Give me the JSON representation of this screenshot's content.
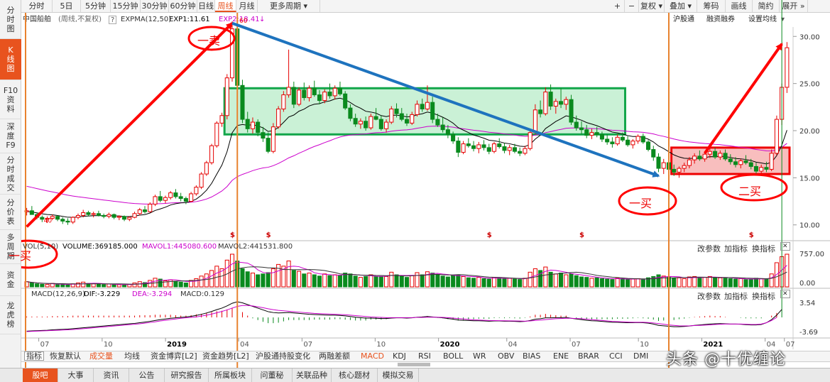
{
  "left_nav": {
    "items": [
      "分时图",
      "K线图",
      "F10资料",
      "深度F9",
      "分时成交",
      "分价表",
      "多周期",
      "资金",
      "龙虎榜"
    ]
  },
  "toolbar": {
    "periods": [
      "分时",
      "5日",
      "5分钟",
      "15分钟",
      "30分钟",
      "60分钟",
      "日线",
      "周线",
      "月线",
      "更多周期"
    ],
    "right": [
      "+",
      "−",
      "复权",
      "叠加",
      "筹码",
      "画线",
      "简约",
      "展开"
    ]
  },
  "info_bar": {
    "stock": "中国船舶",
    "mode": "(周线,不复权)",
    "help": "?",
    "expma": "EXPMA(12,50)",
    "exp1": "EXP1:11.61",
    "exp2": "EXP2:18.41",
    "right_links": [
      "沪股通",
      "融资融券",
      "设置均线"
    ]
  },
  "price_axis": [
    "30.00",
    "25.00",
    "20.00",
    "15.00",
    "10.00"
  ],
  "volume_panel": {
    "title": "VOL(5,10)",
    "volume": "VOLUME:369185.000",
    "mavol1": "MAVOL1:445080.600",
    "mavol2": "MAVOL2:441531.800",
    "axis": [
      "757.00",
      "0.00"
    ],
    "buttons": [
      "改参数",
      "加指标",
      "换指标"
    ]
  },
  "macd_panel": {
    "title": "MACD(12,26,9)",
    "dif": "DIF:-3.229",
    "dea": "DEA:-3.294",
    "macd": "MACD:0.129",
    "axis": [
      "3.54",
      "-3.69"
    ],
    "buttons": [
      "改参数",
      "加指标",
      "换指标"
    ]
  },
  "time_axis": [
    {
      "label": "07",
      "year": false
    },
    {
      "label": "10",
      "year": false
    },
    {
      "label": "2019",
      "year": true
    },
    {
      "label": "04",
      "year": false
    },
    {
      "label": "07",
      "year": false
    },
    {
      "label": "10",
      "year": false
    },
    {
      "label": "2020",
      "year": true
    },
    {
      "label": "04",
      "year": false
    },
    {
      "label": "07",
      "year": false
    },
    {
      "label": "10",
      "year": false
    },
    {
      "label": "2021",
      "year": true
    },
    {
      "label": "04",
      "year": false
    },
    {
      "label": "07",
      "year": false
    }
  ],
  "labels": {
    "high": "60",
    "low": "40",
    "markers": "$"
  },
  "annotations": {
    "sell": "一卖",
    "buy1_left": "一买",
    "buy1_right": "一买",
    "buy2": "二买"
  },
  "indicator_bar": [
    "指标",
    "恢复默认",
    "成交量",
    "均线",
    "资金博弈[L2]",
    "资金趋势[L2]",
    "沪股通持股变化",
    "两融差额",
    "MACD",
    "KDJ",
    "RSI",
    "BOLL",
    "WR",
    "OBV",
    "BIAS",
    "ENE",
    "BRAR",
    "CCI",
    "DMI"
  ],
  "bottom_tabs": [
    "股吧",
    "大事",
    "资讯",
    "公告",
    "研究报告",
    "所属板块",
    "问董秘",
    "关联品种",
    "核心题材",
    "模拟交易"
  ],
  "watermark": "头条 @十优缠论",
  "colors": {
    "up": "#e60000",
    "down": "#0a8a1e",
    "accent": "#e8531e",
    "exp1": "#000000",
    "exp2": "#cc00cc",
    "trend_line": "#1e73be",
    "annotation": "#ff0000",
    "zone_fill": "#b8ecc8",
    "zone_border": "#12a64a",
    "zone2_fill": "#f5a3a3"
  },
  "chart_data": {
    "type": "candlestick",
    "scale": "linear",
    "ylim": [
      9,
      31
    ],
    "period": "weekly",
    "candles": [
      [
        11.4,
        11.8,
        11.0,
        11.5
      ],
      [
        11.5,
        12.0,
        11.2,
        11.1
      ],
      [
        11.1,
        11.3,
        10.6,
        10.8
      ],
      [
        10.8,
        11.0,
        10.3,
        10.6
      ],
      [
        10.6,
        10.9,
        10.2,
        10.7
      ],
      [
        10.7,
        11.1,
        10.5,
        10.9
      ],
      [
        10.9,
        11.0,
        10.4,
        10.6
      ],
      [
        10.6,
        10.8,
        10.1,
        10.4
      ],
      [
        10.4,
        10.7,
        10.0,
        10.3
      ],
      [
        10.3,
        10.9,
        10.1,
        10.8
      ],
      [
        10.8,
        11.2,
        10.6,
        11.0
      ],
      [
        11.0,
        11.6,
        10.8,
        11.3
      ],
      [
        11.3,
        11.5,
        10.9,
        11.1
      ],
      [
        11.1,
        11.4,
        10.8,
        11.2
      ],
      [
        11.2,
        11.5,
        10.9,
        11.0
      ],
      [
        11.0,
        11.2,
        10.7,
        10.9
      ],
      [
        10.9,
        11.3,
        10.7,
        11.1
      ],
      [
        11.1,
        11.2,
        10.6,
        10.8
      ],
      [
        10.8,
        11.0,
        10.5,
        10.9
      ],
      [
        10.9,
        11.0,
        10.4,
        10.6
      ],
      [
        10.6,
        10.9,
        10.4,
        10.8
      ],
      [
        10.8,
        11.4,
        10.7,
        11.2
      ],
      [
        11.2,
        11.8,
        11.0,
        11.6
      ],
      [
        11.6,
        12.0,
        11.2,
        11.4
      ],
      [
        11.4,
        12.4,
        11.3,
        12.2
      ],
      [
        12.2,
        13.2,
        12.0,
        13.0
      ],
      [
        13.0,
        13.6,
        12.4,
        12.6
      ],
      [
        12.6,
        13.1,
        12.3,
        12.9
      ],
      [
        12.9,
        13.6,
        12.7,
        13.4
      ],
      [
        13.4,
        13.8,
        12.8,
        13.0
      ],
      [
        13.0,
        13.4,
        12.5,
        12.8
      ],
      [
        12.8,
        13.0,
        12.2,
        12.5
      ],
      [
        12.5,
        13.5,
        12.4,
        13.3
      ],
      [
        13.3,
        14.2,
        13.1,
        14.0
      ],
      [
        14.0,
        15.6,
        13.8,
        15.4
      ],
      [
        15.4,
        16.8,
        15.2,
        16.6
      ],
      [
        16.6,
        18.6,
        16.4,
        18.4
      ],
      [
        18.4,
        21.0,
        18.2,
        20.8
      ],
      [
        20.8,
        21.9,
        20.4,
        21.6
      ],
      [
        21.6,
        26.0,
        21.2,
        25.6
      ],
      [
        25.6,
        31.6,
        25.2,
        30.8
      ],
      [
        30.8,
        31.2,
        24.5,
        24.8
      ],
      [
        24.8,
        25.4,
        20.8,
        21.2
      ],
      [
        21.2,
        22.0,
        19.8,
        20.2
      ],
      [
        20.2,
        21.4,
        19.7,
        20.9
      ],
      [
        20.9,
        21.2,
        19.4,
        19.8
      ],
      [
        19.8,
        20.4,
        18.8,
        19.2
      ],
      [
        19.2,
        19.8,
        17.6,
        17.8
      ],
      [
        17.8,
        20.8,
        17.6,
        20.4
      ],
      [
        20.4,
        22.6,
        20.2,
        22.3
      ],
      [
        22.3,
        24.2,
        22.0,
        23.8
      ],
      [
        23.8,
        28.6,
        23.5,
        24.6
      ],
      [
        24.6,
        25.2,
        22.4,
        22.8
      ],
      [
        22.8,
        24.6,
        22.6,
        24.3
      ],
      [
        24.3,
        25.1,
        23.2,
        23.5
      ],
      [
        23.5,
        24.8,
        23.1,
        24.5
      ],
      [
        24.5,
        25.3,
        23.6,
        23.8
      ],
      [
        23.8,
        24.3,
        22.8,
        23.2
      ],
      [
        23.2,
        24.4,
        22.9,
        24.1
      ],
      [
        24.1,
        25.0,
        23.4,
        23.7
      ],
      [
        23.7,
        24.8,
        23.3,
        24.5
      ],
      [
        24.5,
        25.2,
        23.7,
        23.9
      ],
      [
        23.9,
        24.2,
        22.2,
        22.4
      ],
      [
        22.4,
        22.8,
        21.0,
        21.3
      ],
      [
        21.3,
        21.8,
        20.4,
        20.7
      ],
      [
        20.7,
        21.3,
        20.2,
        21.0
      ],
      [
        21.0,
        21.5,
        20.0,
        20.3
      ],
      [
        20.3,
        21.8,
        20.1,
        21.5
      ],
      [
        21.5,
        22.4,
        21.1,
        21.2
      ],
      [
        21.2,
        21.6,
        20.0,
        20.2
      ],
      [
        20.2,
        21.2,
        19.8,
        20.9
      ],
      [
        20.9,
        22.6,
        20.7,
        22.3
      ],
      [
        22.3,
        22.9,
        21.4,
        21.8
      ],
      [
        21.8,
        22.4,
        21.0,
        21.2
      ],
      [
        21.2,
        21.8,
        20.5,
        20.8
      ],
      [
        20.8,
        22.0,
        20.6,
        21.7
      ],
      [
        21.7,
        23.2,
        21.5,
        22.8
      ],
      [
        22.8,
        23.4,
        22.0,
        22.3
      ],
      [
        22.3,
        24.8,
        22.1,
        23.0
      ],
      [
        23.0,
        23.6,
        20.8,
        21.2
      ],
      [
        21.2,
        21.8,
        20.4,
        20.6
      ],
      [
        20.6,
        21.4,
        19.8,
        20.1
      ],
      [
        20.1,
        20.6,
        19.2,
        19.6
      ],
      [
        19.6,
        19.9,
        18.6,
        18.9
      ],
      [
        18.9,
        19.3,
        17.2,
        17.7
      ],
      [
        17.7,
        18.9,
        17.5,
        18.6
      ],
      [
        18.6,
        19.2,
        18.2,
        18.4
      ],
      [
        18.4,
        18.9,
        17.8,
        18.1
      ],
      [
        18.1,
        18.8,
        17.6,
        18.5
      ],
      [
        18.5,
        19.0,
        17.9,
        18.2
      ],
      [
        18.2,
        18.6,
        17.5,
        17.8
      ],
      [
        17.8,
        18.8,
        17.6,
        18.6
      ],
      [
        18.6,
        19.2,
        18.1,
        18.3
      ],
      [
        18.3,
        18.7,
        17.6,
        17.9
      ],
      [
        17.9,
        18.5,
        17.4,
        18.2
      ],
      [
        18.2,
        18.6,
        17.6,
        17.8
      ],
      [
        17.8,
        18.2,
        17.3,
        17.6
      ],
      [
        17.6,
        18.4,
        17.4,
        18.1
      ],
      [
        18.1,
        20.2,
        17.9,
        19.8
      ],
      [
        19.8,
        22.8,
        19.6,
        22.2
      ],
      [
        22.2,
        23.2,
        21.4,
        21.8
      ],
      [
        21.8,
        24.6,
        21.6,
        24.1
      ],
      [
        24.1,
        24.9,
        22.2,
        22.6
      ],
      [
        22.6,
        23.4,
        21.8,
        23.1
      ],
      [
        23.1,
        24.5,
        22.4,
        22.8
      ],
      [
        22.8,
        23.6,
        22.2,
        23.3
      ],
      [
        23.3,
        23.8,
        20.6,
        20.9
      ],
      [
        20.9,
        21.6,
        20.0,
        20.3
      ],
      [
        20.3,
        21.0,
        19.6,
        20.1
      ],
      [
        20.1,
        20.6,
        19.2,
        19.5
      ],
      [
        19.5,
        20.2,
        19.1,
        19.8
      ],
      [
        19.8,
        20.4,
        19.3,
        19.6
      ],
      [
        19.6,
        19.9,
        18.8,
        19.1
      ],
      [
        19.1,
        19.6,
        18.5,
        18.8
      ],
      [
        18.8,
        19.3,
        18.2,
        18.6
      ],
      [
        18.6,
        19.6,
        18.4,
        19.3
      ],
      [
        19.3,
        19.8,
        18.8,
        19.0
      ],
      [
        19.0,
        19.4,
        18.3,
        18.5
      ],
      [
        18.5,
        19.1,
        18.1,
        18.9
      ],
      [
        18.9,
        19.6,
        18.6,
        19.4
      ],
      [
        19.4,
        19.7,
        18.6,
        18.8
      ],
      [
        18.8,
        19.0,
        17.8,
        18.0
      ],
      [
        18.0,
        18.4,
        16.8,
        17.2
      ],
      [
        17.2,
        17.6,
        15.6,
        16.0
      ],
      [
        16.0,
        17.0,
        15.4,
        16.6
      ],
      [
        16.6,
        16.9,
        15.6,
        15.9
      ],
      [
        15.9,
        16.4,
        15.2,
        15.6
      ],
      [
        15.6,
        16.2,
        15.0,
        16.0
      ],
      [
        16.0,
        16.6,
        15.6,
        16.3
      ],
      [
        16.3,
        17.2,
        16.0,
        16.9
      ],
      [
        16.9,
        17.6,
        16.5,
        17.3
      ],
      [
        17.3,
        17.9,
        16.8,
        17.0
      ],
      [
        17.0,
        17.8,
        16.7,
        17.5
      ],
      [
        17.5,
        18.3,
        17.1,
        17.8
      ],
      [
        17.8,
        18.2,
        17.0,
        17.2
      ],
      [
        17.2,
        17.9,
        16.9,
        17.6
      ],
      [
        17.6,
        18.0,
        16.8,
        17.0
      ],
      [
        17.0,
        17.5,
        16.4,
        16.7
      ],
      [
        16.7,
        17.2,
        16.1,
        16.4
      ],
      [
        16.4,
        17.0,
        16.0,
        16.8
      ],
      [
        16.8,
        17.4,
        16.4,
        16.6
      ],
      [
        16.6,
        17.0,
        15.9,
        16.2
      ],
      [
        16.2,
        16.6,
        15.4,
        15.7
      ],
      [
        15.7,
        16.4,
        15.2,
        16.1
      ],
      [
        16.1,
        16.7,
        15.6,
        15.9
      ],
      [
        15.9,
        18.0,
        15.7,
        17.6
      ],
      [
        17.6,
        21.6,
        17.4,
        21.2
      ],
      [
        21.2,
        25.0,
        20.6,
        24.6
      ],
      [
        24.6,
        29.4,
        24.0,
        28.8
      ]
    ],
    "volume": [
      120,
      90,
      70,
      60,
      55,
      80,
      60,
      50,
      45,
      70,
      90,
      110,
      80,
      70,
      60,
      50,
      65,
      55,
      50,
      45,
      55,
      90,
      120,
      100,
      150,
      200,
      180,
      140,
      160,
      130,
      110,
      90,
      150,
      190,
      250,
      300,
      380,
      480,
      420,
      620,
      757,
      600,
      420,
      350,
      320,
      280,
      300,
      330,
      420,
      520,
      480,
      600,
      380,
      360,
      300,
      320,
      280,
      250,
      300,
      260,
      280,
      270,
      320,
      300,
      250,
      220,
      240,
      280,
      240,
      230,
      240,
      340,
      280,
      240,
      220,
      260,
      330,
      280,
      350,
      320,
      280,
      250,
      230,
      260,
      280,
      240,
      210,
      200,
      220,
      190,
      180,
      220,
      210,
      190,
      200,
      180,
      170,
      200,
      340,
      420,
      380,
      460,
      340,
      300,
      320,
      280,
      300,
      260,
      230,
      220,
      200,
      210,
      190,
      180,
      170,
      200,
      190,
      170,
      180,
      190,
      170,
      210,
      240,
      280,
      250,
      220,
      200,
      210,
      190,
      230,
      240,
      210,
      220,
      240,
      220,
      210,
      200,
      190,
      180,
      190,
      170,
      180,
      200,
      190,
      180,
      300,
      560,
      700,
      757
    ],
    "macd_dif": [
      -3.1,
      -3.05,
      -3.0,
      -2.95,
      -2.9,
      -2.8,
      -2.75,
      -2.7,
      -2.65,
      -2.55,
      -2.45,
      -2.35,
      -2.25,
      -2.15,
      -2.05,
      -1.95,
      -1.85,
      -1.75,
      -1.65,
      -1.55,
      -1.45,
      -1.35,
      -1.2,
      -1.05,
      -0.9,
      -0.7,
      -0.5,
      -0.35,
      -0.2,
      -0.1,
      0.0,
      0.1,
      0.25,
      0.45,
      0.7,
      1.0,
      1.35,
      1.75,
      2.1,
      2.6,
      3.2,
      3.54,
      3.3,
      2.9,
      2.5,
      2.1,
      1.7,
      1.3,
      1.1,
      1.0,
      1.05,
      1.1,
      1.0,
      0.9,
      0.8,
      0.7,
      0.65,
      0.6,
      0.55,
      0.5,
      0.5,
      0.45,
      0.35,
      0.2,
      0.05,
      -0.05,
      -0.15,
      -0.15,
      -0.2,
      -0.25,
      -0.25,
      -0.15,
      -0.1,
      -0.1,
      -0.15,
      -0.1,
      0.05,
      0.1,
      0.2,
      0.1,
      0.0,
      -0.1,
      -0.25,
      -0.4,
      -0.6,
      -0.65,
      -0.7,
      -0.75,
      -0.75,
      -0.8,
      -0.85,
      -0.8,
      -0.8,
      -0.85,
      -0.85,
      -0.9,
      -0.95,
      -0.9,
      -0.7,
      -0.4,
      -0.3,
      -0.1,
      -0.1,
      -0.05,
      -0.05,
      0.0,
      -0.2,
      -0.35,
      -0.5,
      -0.65,
      -0.75,
      -0.8,
      -0.9,
      -1.0,
      -1.1,
      -1.1,
      -1.15,
      -1.2,
      -1.2,
      -1.15,
      -1.2,
      -1.3,
      -1.5,
      -1.8,
      -1.9,
      -2.0,
      -2.1,
      -2.1,
      -2.05,
      -1.95,
      -1.8,
      -1.7,
      -1.6,
      -1.5,
      -1.45,
      -1.4,
      -1.45,
      -1.5,
      -1.5,
      -1.55,
      -1.65,
      -1.7,
      -1.7,
      -1.6,
      -1.2,
      -0.5,
      0.5,
      1.8
    ],
    "macd_dea": [
      -3.2,
      -3.15,
      -3.1,
      -3.05,
      -3.0,
      -2.95,
      -2.9,
      -2.85,
      -2.8,
      -2.75,
      -2.65,
      -2.55,
      -2.45,
      -2.35,
      -2.25,
      -2.15,
      -2.05,
      -1.95,
      -1.85,
      -1.75,
      -1.65,
      -1.55,
      -1.45,
      -1.3,
      -1.15,
      -1.0,
      -0.8,
      -0.65,
      -0.5,
      -0.35,
      -0.2,
      -0.1,
      0.0,
      0.1,
      0.3,
      0.5,
      0.75,
      1.05,
      1.35,
      1.7,
      2.1,
      2.5,
      2.7,
      2.7,
      2.6,
      2.4,
      2.2,
      1.95,
      1.75,
      1.6,
      1.5,
      1.4,
      1.3,
      1.2,
      1.1,
      1.0,
      0.9,
      0.85,
      0.8,
      0.75,
      0.7,
      0.65,
      0.6,
      0.5,
      0.4,
      0.3,
      0.2,
      0.1,
      0.05,
      0.0,
      -0.05,
      -0.05,
      -0.05,
      -0.05,
      -0.05,
      -0.05,
      0.0,
      0.0,
      0.05,
      0.05,
      0.05,
      0.0,
      -0.05,
      -0.15,
      -0.25,
      -0.35,
      -0.45,
      -0.55,
      -0.6,
      -0.65,
      -0.7,
      -0.72,
      -0.74,
      -0.76,
      -0.78,
      -0.8,
      -0.82,
      -0.85,
      -0.8,
      -0.7,
      -0.6,
      -0.5,
      -0.4,
      -0.3,
      -0.25,
      -0.2,
      -0.2,
      -0.25,
      -0.3,
      -0.4,
      -0.5,
      -0.6,
      -0.7,
      -0.8,
      -0.9,
      -0.95,
      -1.0,
      -1.05,
      -1.1,
      -1.1,
      -1.1,
      -1.15,
      -1.25,
      -1.4,
      -1.55,
      -1.7,
      -1.8,
      -1.9,
      -1.92,
      -1.9,
      -1.85,
      -1.8,
      -1.75,
      -1.7,
      -1.6,
      -1.55,
      -1.5,
      -1.5,
      -1.5,
      -1.5,
      -1.55,
      -1.6,
      -1.6,
      -1.5,
      -1.2,
      -0.7,
      0.0
    ],
    "exp1_start": 11.4,
    "exp2_start": 14.2,
    "exp1_period": 12,
    "exp2_period": 50,
    "trend_lines": [
      {
        "from": [
          0,
          9.8
        ],
        "to": [
          40,
          31.4
        ],
        "color": "#ff0000"
      },
      {
        "from": [
          40,
          31.4
        ],
        "to": [
          123,
          15.2
        ],
        "color": "#1e73be"
      },
      {
        "from": [
          132,
          17.6
        ],
        "to": [
          147,
          29.2
        ],
        "color": "#ff0000"
      }
    ],
    "zones": [
      {
        "from": 39,
        "to": 116,
        "ymin": 19.6,
        "ymax": 24.5,
        "fill": "zone_fill"
      },
      {
        "from": 126,
        "to": 150,
        "ymin": 15.4,
        "ymax": 18.2,
        "fill": "zone2_fill"
      }
    ],
    "highlight_index": 40,
    "low_index": 0
  }
}
